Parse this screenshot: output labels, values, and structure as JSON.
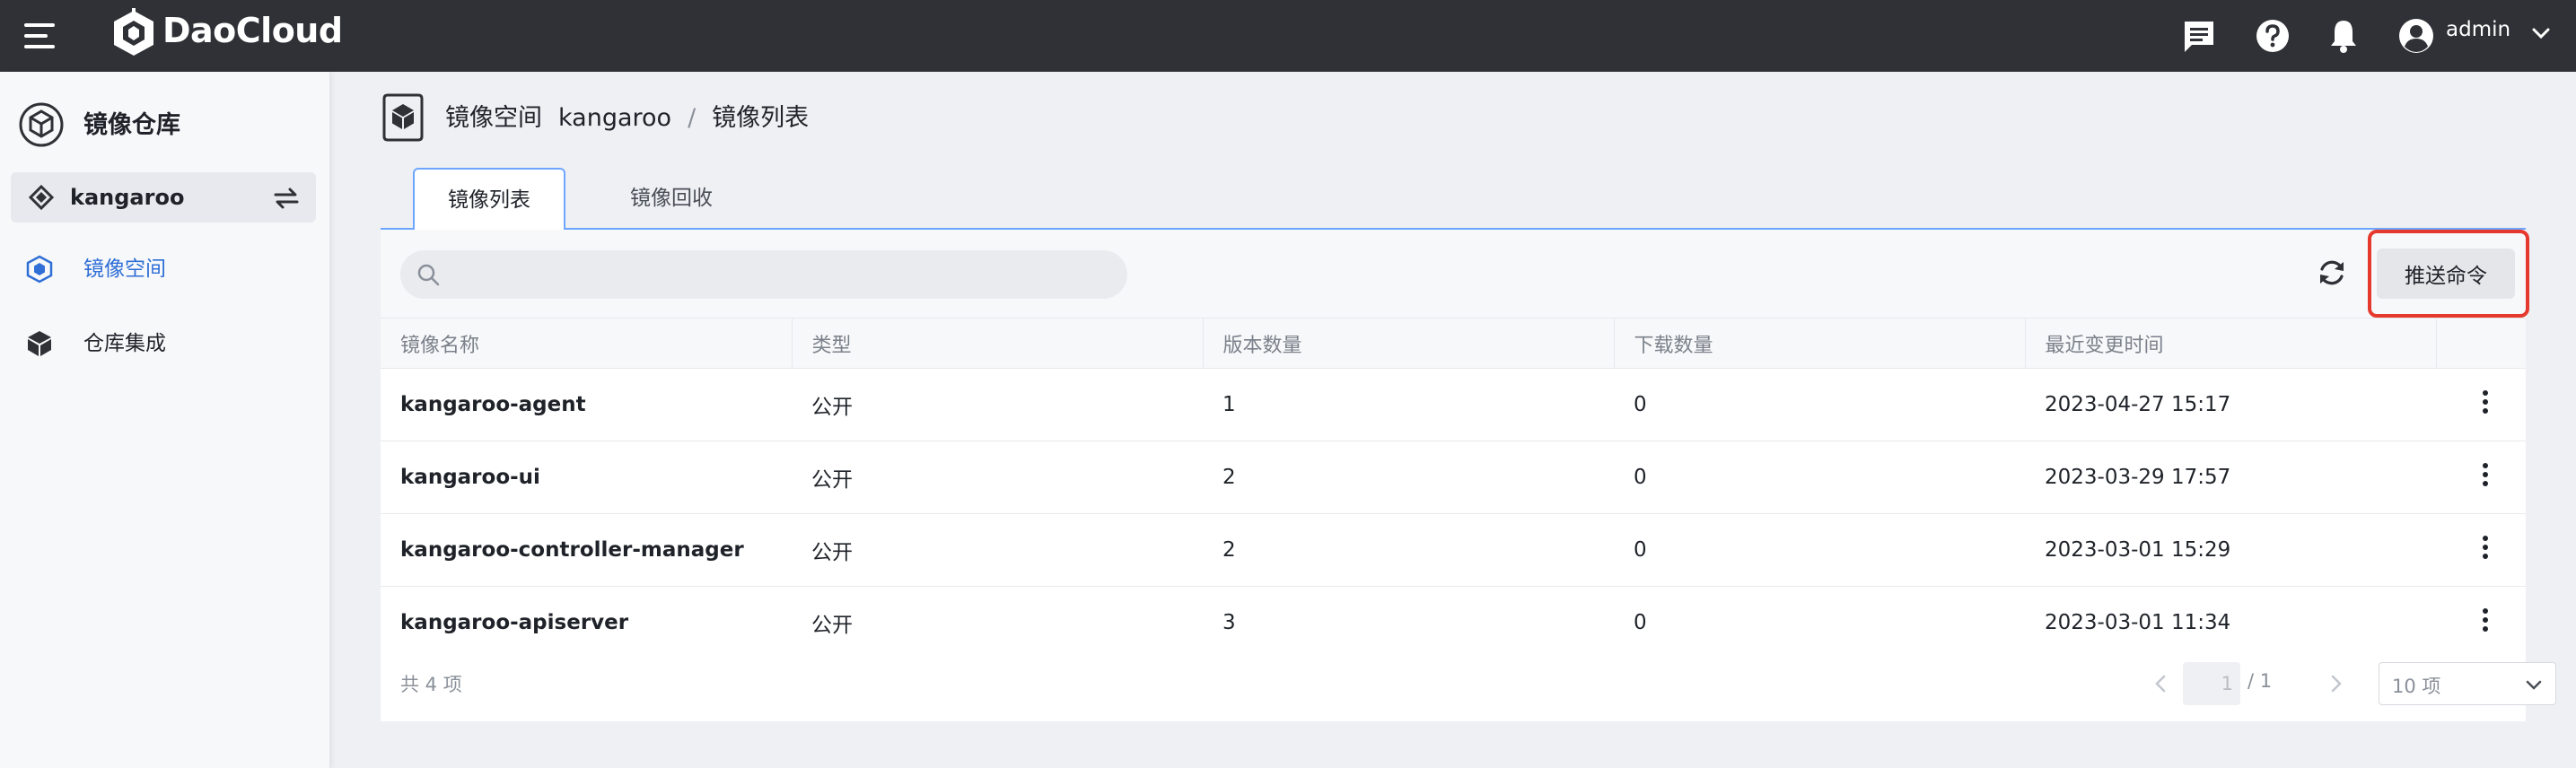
{
  "app": {
    "brand": "DaoCloud"
  },
  "topbar": {
    "user": "admin"
  },
  "sidebar": {
    "title": "镜像仓库",
    "workspace": "kangaroo",
    "items": [
      {
        "label": "镜像空间",
        "active": true
      },
      {
        "label": "仓库集成",
        "active": false
      }
    ]
  },
  "breadcrumb": {
    "root": "镜像空间",
    "workspace": "kangaroo",
    "separator": "/",
    "current": "镜像列表"
  },
  "tabs": [
    {
      "label": "镜像列表",
      "active": true
    },
    {
      "label": "镜像回收",
      "active": false
    }
  ],
  "search": {
    "value": "",
    "placeholder": ""
  },
  "toolbar": {
    "push_label": "推送命令"
  },
  "table": {
    "columns": [
      "镜像名称",
      "类型",
      "版本数量",
      "下载数量",
      "最近变更时间",
      ""
    ],
    "rows": [
      {
        "name": "kangaroo-agent",
        "type": "公开",
        "versions": "1",
        "downloads": "0",
        "updated": "2023-04-27 15:17"
      },
      {
        "name": "kangaroo-ui",
        "type": "公开",
        "versions": "2",
        "downloads": "0",
        "updated": "2023-03-29 17:57"
      },
      {
        "name": "kangaroo-controller-manager",
        "type": "公开",
        "versions": "2",
        "downloads": "0",
        "updated": "2023-03-01 15:29"
      },
      {
        "name": "kangaroo-apiserver",
        "type": "公开",
        "versions": "3",
        "downloads": "0",
        "updated": "2023-03-01 11:34"
      }
    ]
  },
  "footer": {
    "total": "共 4 项",
    "page": "1",
    "page_total": "/ 1",
    "page_size": "10 项"
  },
  "colors": {
    "topbar": "#2f3136",
    "accent": "#2f6fd6",
    "highlight": "#e6392e"
  }
}
